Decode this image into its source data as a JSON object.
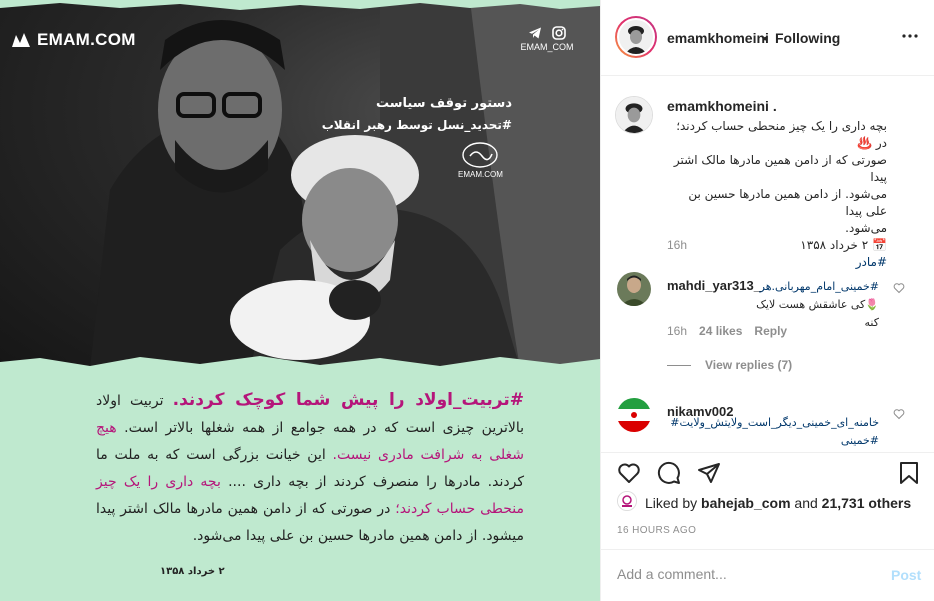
{
  "image": {
    "brand": "EMAM.COM",
    "social_domain": "EMAM_COM",
    "title": "دستور توقف سیاست",
    "hashtag": "#تحدید_نسل توسط رهبر انقلاب",
    "seal_domain": "EMAM.COM",
    "quote": {
      "p1": "#تربیت_اولاد را پیش شما کوچک کردند.",
      "p2": " تربیت اولاد بالاترین چیزی است که در همه جوامع از همه شغلها بالاتر است. ",
      "p3": "هیچ شغلی به شرافت مادری نیست.",
      "p4": " این خیانت بزرگی است که به ملت ما کردند. مادرها را منصرف کردند از بچه داری .... ",
      "p5": "بچه داری را یک چیز منحطی حساب کردند؛",
      "p6": " در صورتی که از دامن همین مادرها مالک اشتر پیدا میشود. از دامن همین مادرها حسین بن علی پیدا می‌شود."
    },
    "date": "۲ خرداد ۱۳۵۸"
  },
  "header": {
    "username": "emamkhomeini",
    "separator": "•",
    "follow_status": "Following"
  },
  "caption": {
    "username": "emamkhomeini .",
    "lines": [
      "بچه داری را یک چیز منحطی حساب کردند؛ در ♨️",
      "صورتی که از دامن همین مادرها مالک اشتر پیدا",
      "می‌شود. از دامن همین مادرها حسین بن علی پیدا",
      "می‌شود.",
      "📅 ۲ خرداد ۱۳۵۸"
    ],
    "hashtag": "#مادر",
    "time": "16h"
  },
  "comments": [
    {
      "username": "mahdi_yar313_",
      "lines": [
        "#خمینی_امام_مهربانی.هر",
        "🌷کی عاشقش هست لایک کنه"
      ],
      "time": "16h",
      "likes": "24 likes",
      "reply": "Reply",
      "view_replies": "View replies (7)"
    },
    {
      "username": "nikamv002",
      "lines": [
        "خامنه_ای_خمینی_دیگر_است_ولایتش_ولایت#",
        "#خمینی"
      ]
    }
  ],
  "actions": {
    "liked_prefix": "Liked by ",
    "liked_user": "bahejab_com",
    "liked_and": " and ",
    "liked_others": "21,731 others",
    "age": "16 HOURS AGO",
    "comment_placeholder": "Add a comment...",
    "post_label": "Post"
  },
  "colors": {
    "accent": "#b5157a",
    "link": "#00376b",
    "muted": "#8e8e8e",
    "post_disabled": "#b2dffc",
    "panel": "#bfe9cf"
  },
  "icons": [
    "emam-logo-icon",
    "telegram-icon",
    "instagram-icon",
    "more-icon",
    "heart-icon",
    "comment-icon",
    "share-icon",
    "bookmark-icon"
  ]
}
